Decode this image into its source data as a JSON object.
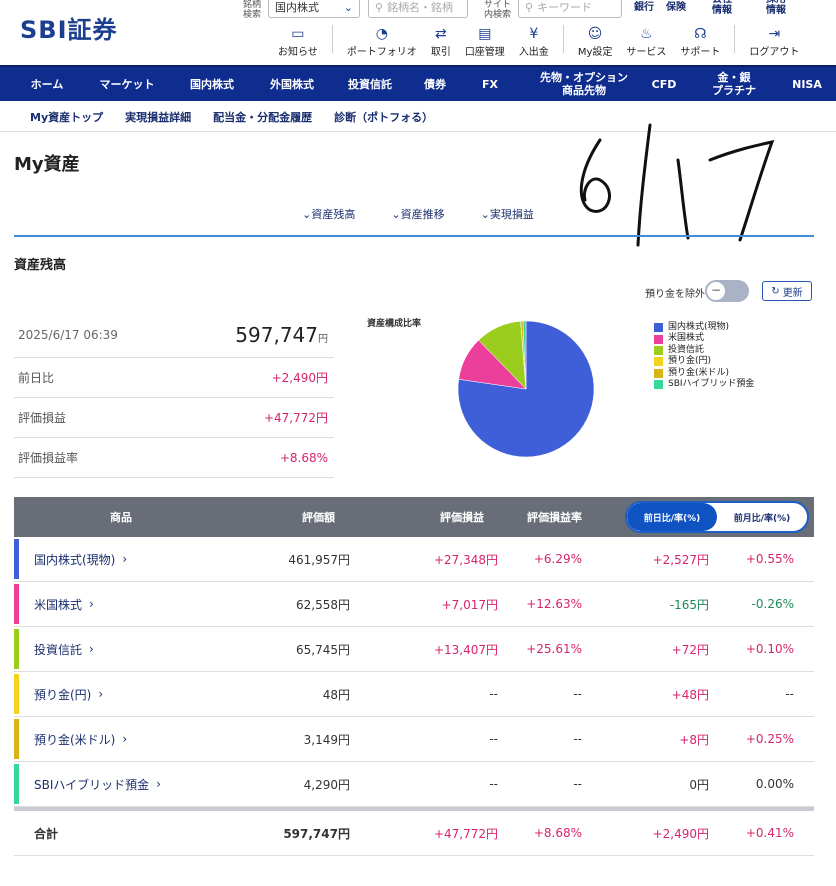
{
  "brand": {
    "logo_text": "SBI証券"
  },
  "header": {
    "search_label1": "銘柄\n検索",
    "market_select": "国内株式",
    "search_placeholder": "銘柄名・銘柄",
    "search_label2": "サイト\n内検索",
    "keyword_placeholder": "キーワード",
    "links": [
      "銀行",
      "保険",
      "会社\n情報",
      "採用\n情報"
    ],
    "toolbar": [
      {
        "label": "お知らせ",
        "icon": "message-icon"
      },
      {
        "label": "ポートフォリオ",
        "icon": "portfolio-icon"
      },
      {
        "label": "取引",
        "icon": "trade-icon"
      },
      {
        "label": "口座管理",
        "icon": "account-icon"
      },
      {
        "label": "入出金",
        "icon": "yen-icon"
      },
      {
        "label": "My設定",
        "icon": "user-icon"
      },
      {
        "label": "サービス",
        "icon": "service-icon"
      },
      {
        "label": "サポート",
        "icon": "support-icon"
      },
      {
        "label": "ログアウト",
        "icon": "logout-icon"
      }
    ]
  },
  "nav": [
    "ホーム",
    "マーケット",
    "国内株式",
    "外国株式",
    "投資信託",
    "債券",
    "FX",
    "先物・オプション\n商品先物",
    "CFD",
    "金・銀\nプラチナ",
    "NISA"
  ],
  "subnav": [
    "My資産トップ",
    "実現損益詳細",
    "配当金・分配金履歴",
    "診断（ポトフォる）"
  ],
  "page_title": "My資産",
  "anchors": [
    "資産残高",
    "資産推移",
    "実現損益"
  ],
  "section_title": "資産残高",
  "handwritten_note": "6/17",
  "toggle_label": "預り金を除外",
  "refresh_label": "更新",
  "summary": {
    "datetime": "2025/6/17 06:39",
    "total": "597,747",
    "unit": "円",
    "rows": [
      {
        "label": "前日比",
        "value": "+2,490円"
      },
      {
        "label": "評価損益",
        "value": "+47,772円"
      },
      {
        "label": "評価損益率",
        "value": "+8.68%"
      }
    ]
  },
  "chart_data": {
    "type": "pie",
    "title": "資産構成比率",
    "series": [
      {
        "name": "国内株式(現物)",
        "value": 461957,
        "color": "#3f5fd9"
      },
      {
        "name": "米国株式",
        "value": 62558,
        "color": "#ec3f9b"
      },
      {
        "name": "投資信託",
        "value": 65745,
        "color": "#9acd1e"
      },
      {
        "name": "預り金(円)",
        "value": 48,
        "color": "#f2d41e"
      },
      {
        "name": "預り金(米ドル)",
        "value": 3149,
        "color": "#d8b417"
      },
      {
        "name": "SBIハイブリッド預金",
        "value": 4290,
        "color": "#36d89a"
      }
    ]
  },
  "table": {
    "headers": [
      "商品",
      "評価額",
      "評価損益",
      "評価損益率"
    ],
    "toggle": [
      "前日比/率(%)",
      "前月比/率(%)"
    ],
    "rows": [
      {
        "name": "国内株式(現物)",
        "color": "#3f5fd9",
        "value": "461,957円",
        "pl": "+27,348円",
        "plr": "+6.29%",
        "d": "+2,527円",
        "dr": "+0.55%",
        "ds": "pos",
        "drs": "pos"
      },
      {
        "name": "米国株式",
        "color": "#ec3f9b",
        "value": "62,558円",
        "pl": "+7,017円",
        "plr": "+12.63%",
        "d": "-165円",
        "dr": "-0.26%",
        "ds": "neg",
        "drs": "neg"
      },
      {
        "name": "投資信託",
        "color": "#9acd1e",
        "value": "65,745円",
        "pl": "+13,407円",
        "plr": "+25.61%",
        "d": "+72円",
        "dr": "+0.10%",
        "ds": "pos",
        "drs": "pos"
      },
      {
        "name": "預り金(円)",
        "color": "#f2d41e",
        "value": "48円",
        "pl": "--",
        "plr": "--",
        "d": "+48円",
        "dr": "--",
        "ds": "pos",
        "drs": "none"
      },
      {
        "name": "預り金(米ドル)",
        "color": "#d8b417",
        "value": "3,149円",
        "pl": "--",
        "plr": "--",
        "d": "+8円",
        "dr": "+0.25%",
        "ds": "pos",
        "drs": "pos"
      },
      {
        "name": "SBIハイブリッド預金",
        "color": "#36d89a",
        "value": "4,290円",
        "pl": "--",
        "plr": "--",
        "d": "0円",
        "dr": "0.00%",
        "ds": "none",
        "drs": "none"
      }
    ],
    "total": {
      "name": "合計",
      "value": "597,747円",
      "pl": "+47,772円",
      "plr": "+8.68%",
      "d": "+2,490円",
      "dr": "+0.41%"
    }
  }
}
